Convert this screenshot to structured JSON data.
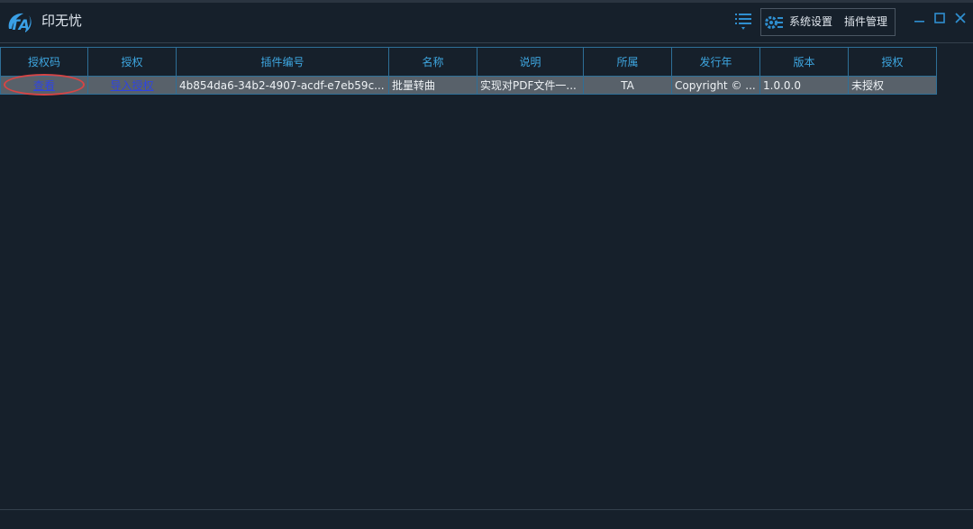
{
  "app": {
    "title": "印无忧",
    "logo_text": "TA"
  },
  "toolbar": {
    "system_settings": "系统设置",
    "plugin_management": "插件管理"
  },
  "colors": {
    "background": "#16202b",
    "header_text": "#3ea6e0",
    "grid_border": "#2e6f97",
    "row_background": "#58616a",
    "link": "#2f45e0",
    "highlight_circle": "#d64545",
    "window_buttons": "#2f8fd0"
  },
  "icons": {
    "menu": "list-menu-icon",
    "settings": "gear-icon",
    "minimize": "minimize-icon",
    "maximize": "maximize-icon",
    "close": "close-icon"
  },
  "table": {
    "columns": [
      "授权码",
      "授权",
      "插件编号",
      "名称",
      "说明",
      "所属",
      "发行年",
      "版本",
      "授权"
    ],
    "rows": [
      {
        "auth_code": "查看",
        "auth_action": "导入授权",
        "plugin_id": "4b854da6-34b2-4907-acdf-e7eb59c...",
        "name": "批量转曲",
        "description": "实现对PDF文件一...",
        "owner": "TA",
        "release": "Copyright © ...",
        "version": "1.0.0.0",
        "status": "未授权"
      }
    ]
  }
}
